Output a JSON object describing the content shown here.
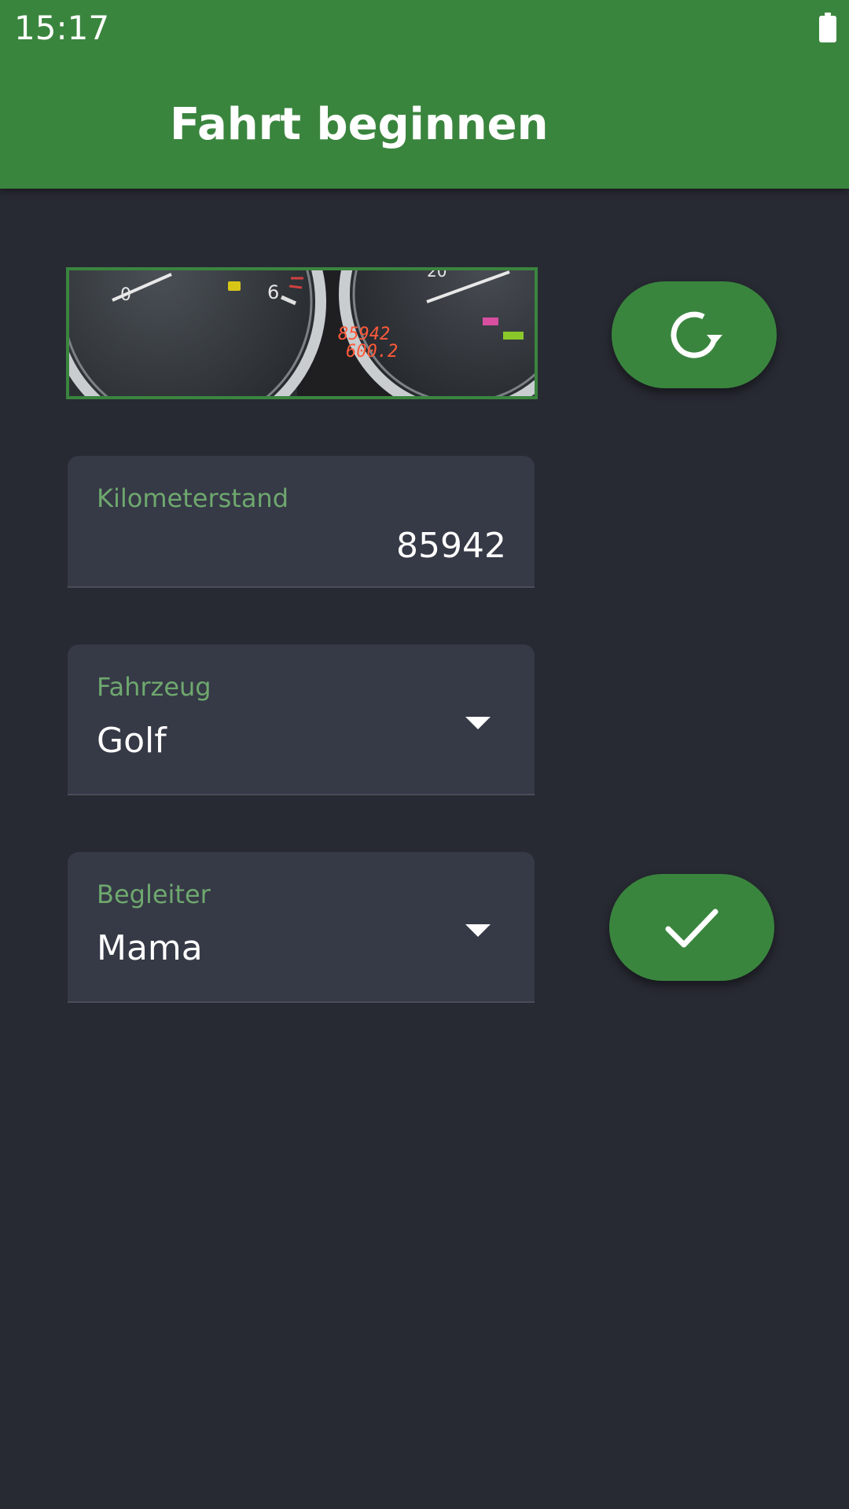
{
  "status_bar": {
    "time": "15:17",
    "battery_icon": "battery-full-icon"
  },
  "app_bar": {
    "title": "Fahrt beginnen"
  },
  "photo": {
    "description_icon": "odometer-photo",
    "odometer_readout": "85942",
    "trip_readout": "600.2",
    "gauge_mark_6": "6",
    "gauge_mark_0": "0",
    "gauge_mark_20": "20"
  },
  "actions": {
    "retake_icon": "refresh-icon",
    "confirm_icon": "check-icon"
  },
  "form": {
    "mileage": {
      "label": "Kilometerstand",
      "value": "85942"
    },
    "vehicle": {
      "label": "Fahrzeug",
      "value": "Golf"
    },
    "companion": {
      "label": "Begleiter",
      "value": "Mama"
    }
  },
  "colors": {
    "primary": "#3a853e",
    "background": "#282a33",
    "field_background": "#363946",
    "label": "#6ea86e"
  }
}
